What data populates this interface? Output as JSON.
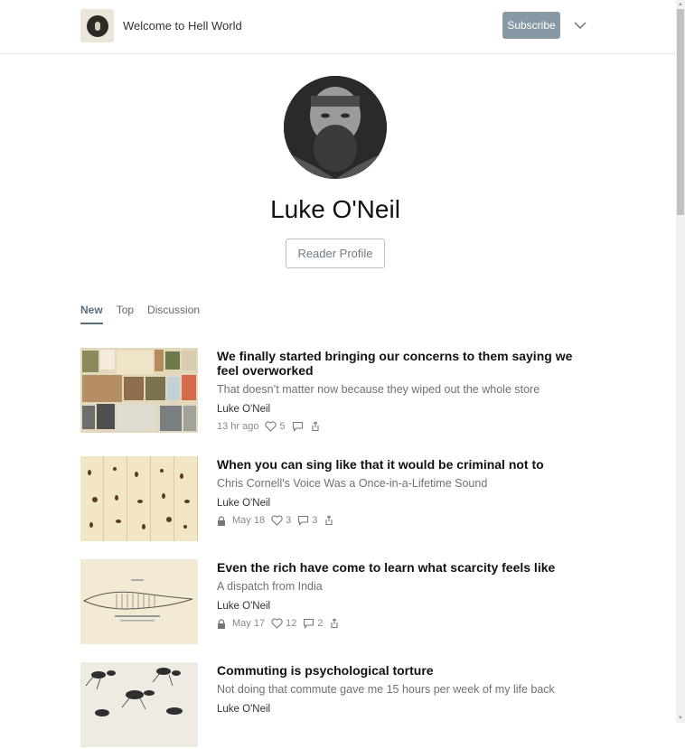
{
  "header": {
    "publication_name": "Welcome to Hell World",
    "subscribe_label": "Subscribe",
    "logo_icon": "publication-logo-icon",
    "menu_icon": "chevron-down-icon"
  },
  "profile": {
    "name": "Luke O'Neil",
    "reader_profile_label": "Reader Profile"
  },
  "tabs": [
    {
      "label": "New",
      "active": true
    },
    {
      "label": "Top",
      "active": false
    },
    {
      "label": "Discussion",
      "active": false
    }
  ],
  "posts": [
    {
      "title": "We finally started bringing our concerns to them saying we feel overworked",
      "subtitle": "That doesn’t matter now because they wiped out the whole store",
      "author": "Luke O'Neil",
      "date": "13 hr ago",
      "likes": "5",
      "comments": "",
      "locked": false
    },
    {
      "title": "When you can sing like that it would be criminal not to",
      "subtitle": "Chris Cornell's Voice Was a Once-in-a-Lifetime Sound",
      "author": "Luke O'Neil",
      "date": "May 18",
      "likes": "3",
      "comments": "3",
      "locked": true
    },
    {
      "title": "Even the rich have come to learn what scarcity feels like",
      "subtitle": "A dispatch from India",
      "author": "Luke O'Neil",
      "date": "May 17",
      "likes": "12",
      "comments": "2",
      "locked": true
    },
    {
      "title": "Commuting is psychological torture",
      "subtitle": "Not doing that commute gave me 15 hours per week of my life back",
      "author": "Luke O'Neil",
      "date": "",
      "likes": "",
      "comments": "",
      "locked": false
    }
  ],
  "colors": {
    "subscribe_bg": "#8799a4",
    "accent": "#54707f"
  }
}
